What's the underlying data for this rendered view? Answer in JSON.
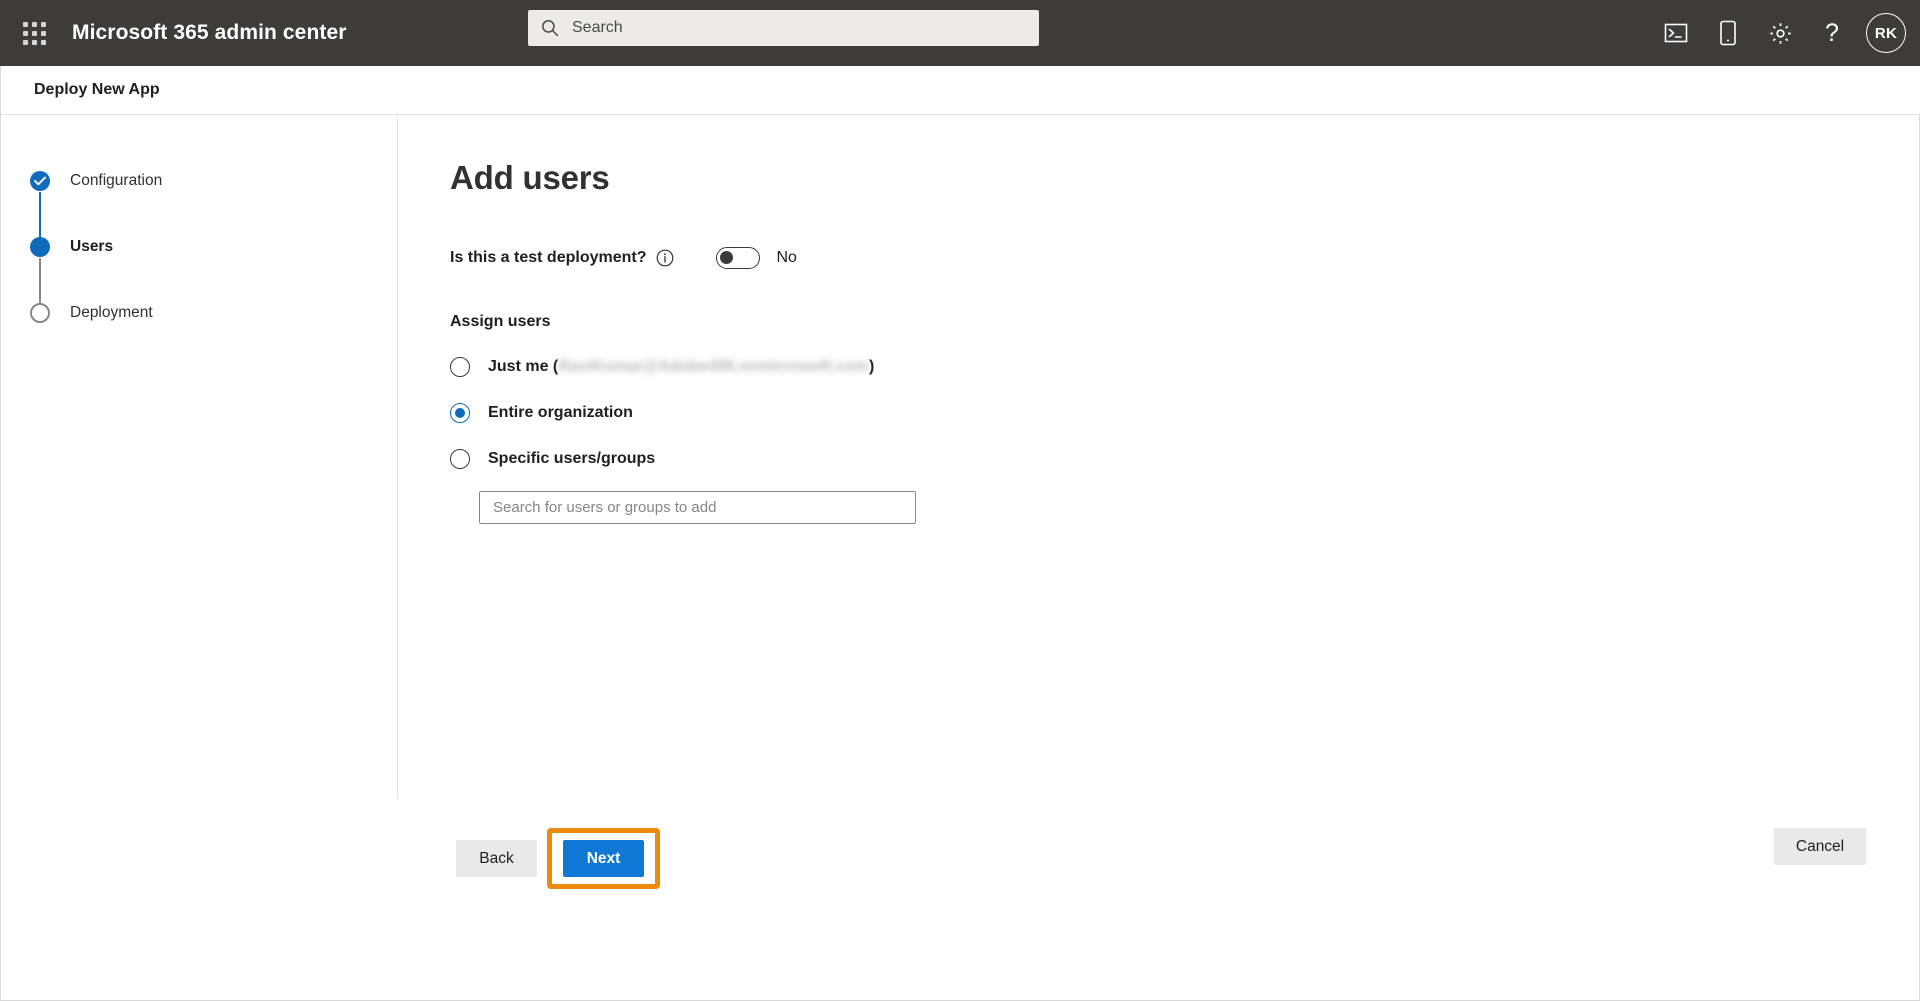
{
  "suite": {
    "waffle_icon": "app-launcher-waffle-icon",
    "title": "Microsoft 365 admin center",
    "search": {
      "icon": "search-icon",
      "placeholder": "Search"
    },
    "actions": [
      {
        "name": "console-icon",
        "label": "Open console"
      },
      {
        "name": "mobile-icon",
        "label": "Mobile"
      },
      {
        "name": "gear-icon",
        "label": "Settings"
      },
      {
        "name": "help-icon",
        "label": "?"
      }
    ],
    "avatar": {
      "initials": "RK",
      "name": "account-avatar"
    }
  },
  "page": {
    "breadcrumb": "Deploy New App"
  },
  "stepper": {
    "steps": [
      {
        "label": "Configuration",
        "state": "done",
        "bullet": "check-circle-icon"
      },
      {
        "label": "Users",
        "state": "current",
        "bullet": "filled-circle-icon"
      },
      {
        "label": "Deployment",
        "state": "todo",
        "bullet": "empty-circle-icon"
      }
    ]
  },
  "main": {
    "title": "Add users",
    "test_deployment": {
      "question": "Is this a test deployment?",
      "info_icon": "info-icon",
      "toggle_state": "off",
      "toggle_label": "No"
    },
    "assign_users": {
      "section_label": "Assign users",
      "selected": "entire-organization",
      "options": [
        {
          "id": "just-me",
          "label_prefix": "Just me (",
          "redacted_value": "RaviKumar@Adobe496.onmicrosoft.com",
          "label_suffix": ")",
          "checked": false
        },
        {
          "id": "entire-organization",
          "label_prefix": "Entire organization",
          "redacted_value": "",
          "label_suffix": "",
          "checked": true
        },
        {
          "id": "specific-users-groups",
          "label_prefix": "Specific users/groups",
          "redacted_value": "",
          "label_suffix": "",
          "checked": false
        }
      ],
      "search": {
        "placeholder": "Search for users or groups to add",
        "value": ""
      }
    }
  },
  "footer": {
    "back_label": "Back",
    "next_label": "Next",
    "cancel_label": "Cancel",
    "highlighted_control": "next-button"
  },
  "colors": {
    "suite_bar": "#3d3c3b",
    "accent_blue": "#0f6cbd",
    "primary_button": "#0f78d4",
    "highlight_orange": "#eb8c10",
    "neutral_button": "#e9e9e9",
    "step_inactive": "#8a8886"
  }
}
